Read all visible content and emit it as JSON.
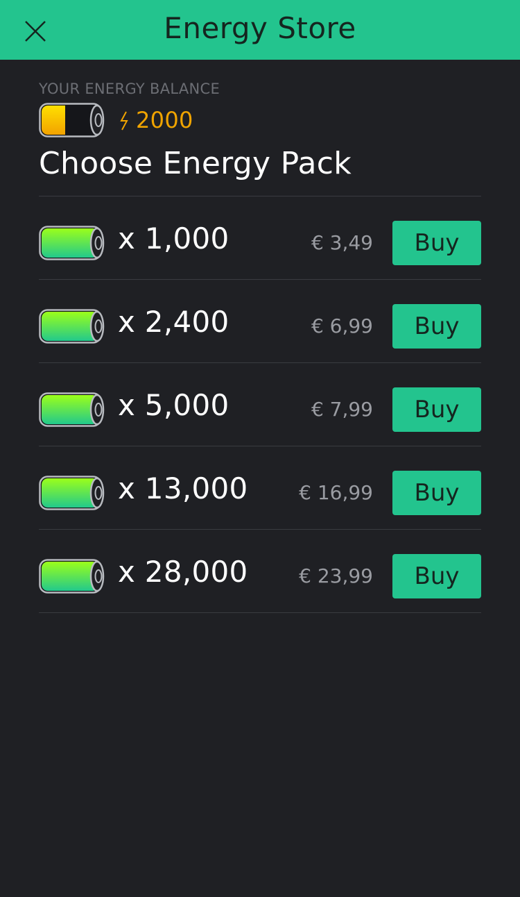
{
  "header": {
    "title": "Energy Store",
    "close_icon": "close-icon",
    "background": "#23c48e"
  },
  "balance": {
    "label": "YOUR ENERGY BALANCE",
    "value": "2000",
    "icon": "battery-half-icon",
    "bolt_icon": "lightning-icon",
    "value_color": "#f0a400"
  },
  "section_title": "Choose Energy Pack",
  "packs": [
    {
      "amount": "x 1,000",
      "price": "€ 3,49",
      "button": "Buy"
    },
    {
      "amount": "x 2,400",
      "price": "€ 6,99",
      "button": "Buy"
    },
    {
      "amount": "x 5,000",
      "price": "€ 7,99",
      "button": "Buy"
    },
    {
      "amount": "x 13,000",
      "price": "€ 16,99",
      "button": "Buy"
    },
    {
      "amount": "x 28,000",
      "price": "€ 23,99",
      "button": "Buy"
    }
  ],
  "colors": {
    "background": "#1f2024",
    "accent": "#23c48e",
    "divider": "#3a3c41"
  }
}
